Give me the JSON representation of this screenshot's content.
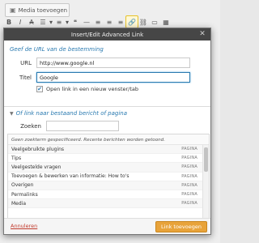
{
  "editor": {
    "media_button": "Media toevoegen"
  },
  "modal": {
    "title": "Insert/Edit Advanced Link",
    "url_section": {
      "heading": "Geef de URL van de bestemming",
      "url_label": "URL",
      "url_value": "http://www.google.nl",
      "title_label": "Titel",
      "title_value": "Google",
      "new_window_label": "Open link in een nieuw venster/tab",
      "new_window_checked": true
    },
    "search_section": {
      "heading": "Of link naar bestaand bericht of pagina",
      "search_label": "Zoeken",
      "search_value": ""
    },
    "results": {
      "note": "Geen zoekterm gespecificeerd. Recente berichten worden getoond.",
      "items": [
        {
          "title": "Veelgebruikte plugins",
          "type": "PAGINA"
        },
        {
          "title": "Tips",
          "type": "PAGINA"
        },
        {
          "title": "Veelgestelde vragen",
          "type": "PAGINA"
        },
        {
          "title": "Toevoegen & bewerken van informatie: How to's",
          "type": "PAGINA"
        },
        {
          "title": "Overigen",
          "type": "PAGINA"
        },
        {
          "title": "Permalinks",
          "type": "PAGINA"
        },
        {
          "title": "Media",
          "type": "PAGINA"
        }
      ]
    },
    "footer": {
      "cancel_label": "Annuleren",
      "submit_label": "Link toevoegen"
    }
  },
  "colors": {
    "header_bg": "#464646",
    "accent": "#2a7ab0",
    "submit_bg": "#e8a33a",
    "cancel": "#c0392b"
  }
}
